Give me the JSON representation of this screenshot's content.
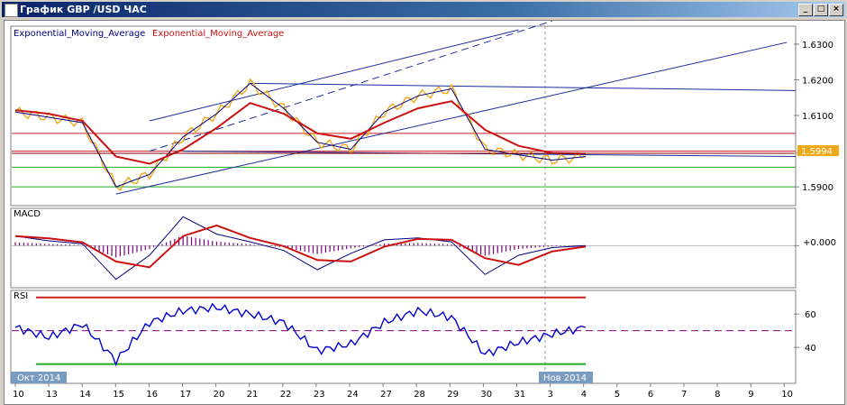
{
  "window": {
    "title": "График GBP /USD  ЧАС",
    "btn_min": "_",
    "btn_max": "□",
    "btn_close": "×"
  },
  "colors": {
    "price": "#f0a818",
    "ema_fast": "#000080",
    "ema_slow": "#cc1111",
    "channel": "#1c2d9c",
    "support": "#22aa22",
    "resistance": "#cc2222",
    "current_price_bg": "#f0a818"
  },
  "main_pane": {
    "legend1": "Exponential_Moving_Average",
    "legend2": "Exponential_Moving_Average",
    "price_label": "1.5994"
  },
  "macd_pane": {
    "title": "MACD",
    "zero_label": "+0.000"
  },
  "rsi_pane": {
    "title": "RSI"
  },
  "x_axis": {
    "month_left": "Окт 2014",
    "month_right": "Нов 2014"
  },
  "chart_data": [
    {
      "type": "line",
      "panel": "price",
      "y_ticks": [
        "1.6300",
        "1.6200",
        "1.6100",
        "1.5994",
        "1.5900"
      ],
      "x_ticks": [
        "10",
        "13",
        "14",
        "15",
        "16",
        "17",
        "20",
        "21",
        "22",
        "23",
        "24",
        "27",
        "28",
        "29",
        "30",
        "31",
        "3",
        "4",
        "5",
        "6",
        "7",
        "8",
        "9",
        "10"
      ],
      "x_index": [
        0,
        1,
        2,
        3,
        4,
        5,
        6,
        7,
        8,
        9,
        10,
        11,
        12,
        13,
        14,
        15,
        16,
        17,
        18,
        19,
        20,
        21,
        22,
        23
      ],
      "series": [
        {
          "name": "Exponential_Moving_Average",
          "values": [
            1.611,
            1.6095,
            1.608,
            1.59,
            1.5935,
            1.604,
            1.6105,
            1.619,
            1.612,
            1.6025,
            1.6005,
            1.611,
            1.6155,
            1.6175,
            1.6005,
            1.599,
            1.5975,
            1.5985
          ]
        },
        {
          "name": "Exponential_Moving_Average",
          "values": [
            1.6115,
            1.6105,
            1.6085,
            1.5985,
            1.5965,
            1.6005,
            1.6065,
            1.6135,
            1.6105,
            1.605,
            1.6035,
            1.608,
            1.612,
            1.614,
            1.606,
            1.6015,
            1.5995,
            1.5993
          ]
        }
      ],
      "levels": {
        "resistance": [
          1.605,
          1.6
        ],
        "support": [
          1.5955,
          1.59
        ]
      },
      "ylim": [
        1.586,
        1.632
      ]
    },
    {
      "type": "bar",
      "panel": "macd",
      "y_ticks": [
        "+0.000"
      ],
      "values": [
        0.001,
        0.0005,
        0.0002,
        -0.0035,
        -0.001,
        0.003,
        0.0012,
        0.0004,
        -0.0005,
        -0.0025,
        -0.0008,
        0.0006,
        0.0008,
        0.0004,
        -0.003,
        -0.001,
        -0.0002,
        0.0
      ],
      "ylim": [
        -0.004,
        0.0035
      ]
    },
    {
      "type": "line",
      "panel": "rsi",
      "y_ticks": [
        "60",
        "40"
      ],
      "values": [
        52,
        46,
        54,
        32,
        55,
        62,
        64,
        60,
        55,
        38,
        42,
        55,
        62,
        58,
        36,
        43,
        48,
        52
      ],
      "levels": [
        70,
        50,
        30
      ],
      "ylim": [
        26,
        72
      ]
    }
  ]
}
